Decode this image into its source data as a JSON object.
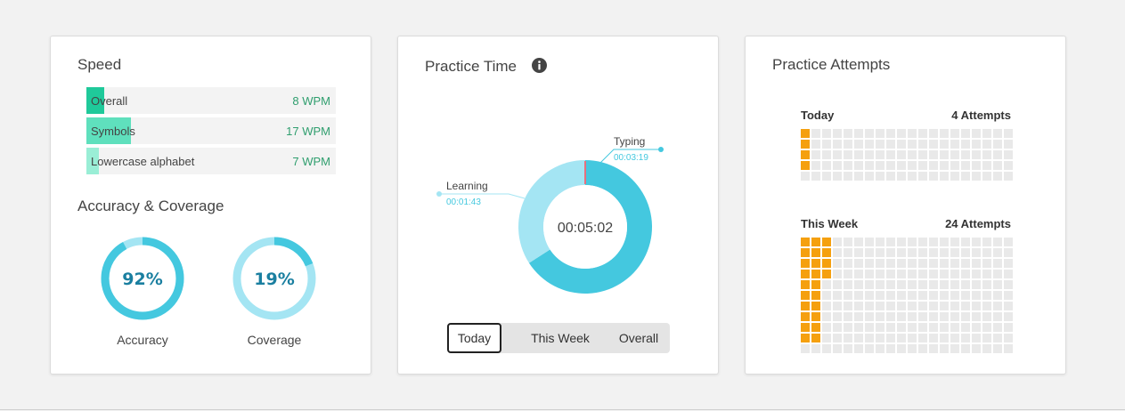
{
  "speed": {
    "title": "Speed",
    "rows": [
      {
        "label": "Overall",
        "value": "8 WPM",
        "fill": 0.07,
        "color": "#1fc99a"
      },
      {
        "label": "Symbols",
        "value": "17 WPM",
        "fill": 0.18,
        "color": "#5fe0bd"
      },
      {
        "label": "Lowercase alphabet",
        "value": "7 WPM",
        "fill": 0.05,
        "color": "#9aeed6"
      }
    ]
  },
  "accuracy": {
    "title": "Accuracy & Coverage",
    "items": [
      {
        "value": "92%",
        "label": "Accuracy",
        "fraction": 0.92
      },
      {
        "value": "19%",
        "label": "Coverage",
        "fraction": 0.19
      }
    ]
  },
  "practice_time": {
    "title": "Practice Time",
    "center": "00:05:02",
    "typing": {
      "label": "Typing",
      "time": "00:03:19",
      "seconds": 199
    },
    "learning": {
      "label": "Learning",
      "time": "00:01:43",
      "seconds": 103
    },
    "tabs": [
      "Today",
      "This Week",
      "Overall"
    ],
    "active_tab": "Today"
  },
  "attempts": {
    "title": "Practice Attempts",
    "today": {
      "label": "Today",
      "count": "4 Attempts",
      "per_day": [
        4
      ]
    },
    "week": {
      "label": "This Week",
      "count": "24 Attempts",
      "per_day": [
        10,
        10,
        4
      ]
    }
  },
  "colors": {
    "typing": "#44c8df",
    "learning": "#a4e5f3",
    "marker": "#e8707e",
    "attempt": "#f5a00f"
  }
}
